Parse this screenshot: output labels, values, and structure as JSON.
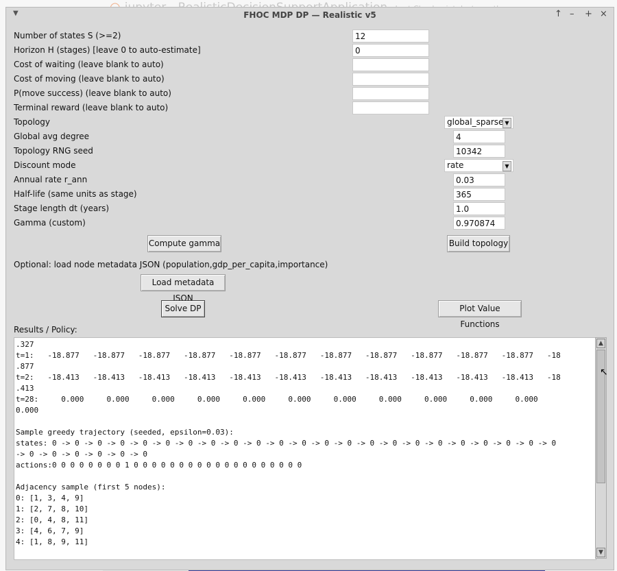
{
  "background": {
    "logo": "◠",
    "app_name": "jupyter",
    "notebook_title": "RealisticDecisionSupportApplication",
    "checkpoint": "Last Checkpoint: last month"
  },
  "window": {
    "title": "FHOC MDP DP — Realistic v5",
    "controls": {
      "menu": "▼",
      "up": "↑",
      "minimize": "–",
      "maximize": "+",
      "close": "×"
    }
  },
  "form": {
    "num_states": {
      "label": "Number of states S (>=2)",
      "value": "12"
    },
    "horizon": {
      "label": "Horizon H (stages) [leave 0 to auto-estimate]",
      "value": "0"
    },
    "cost_waiting": {
      "label": "Cost of waiting (leave blank to auto)",
      "value": ""
    },
    "cost_moving": {
      "label": "Cost of moving (leave blank to auto)",
      "value": ""
    },
    "p_move": {
      "label": "P(move success) (leave blank to auto)",
      "value": ""
    },
    "terminal_reward": {
      "label": "Terminal reward (leave blank to auto)",
      "value": ""
    },
    "topology": {
      "label": "Topology",
      "value": "global_sparse"
    },
    "global_avg_degree": {
      "label": "Global avg degree",
      "value": "4"
    },
    "topology_seed": {
      "label": "Topology RNG seed",
      "value": "10342"
    },
    "discount_mode": {
      "label": "Discount mode",
      "value": "rate"
    },
    "annual_rate": {
      "label": "Annual rate r_ann",
      "value": "0.03"
    },
    "half_life": {
      "label": "Half-life (same units as stage)",
      "value": "365"
    },
    "stage_length": {
      "label": "Stage length dt (years)",
      "value": "1.0"
    },
    "gamma": {
      "label": "Gamma (custom)",
      "value": "0.970874"
    }
  },
  "buttons": {
    "compute_gamma": "Compute gamma",
    "build_topology": "Build topology",
    "load_metadata": "Load metadata JSON",
    "solve": "Solve DP",
    "plot": "Plot Value Functions"
  },
  "metadata_label": "Optional: load node metadata JSON (population,gdp_per_capita,importance)",
  "results_label": "Results / Policy:",
  "results_lines": [
    ".327",
    "t=1:   -18.877   -18.877   -18.877   -18.877   -18.877   -18.877   -18.877   -18.877   -18.877   -18.877   -18.877   -18",
    ".877",
    "t=2:   -18.413   -18.413   -18.413   -18.413   -18.413   -18.413   -18.413   -18.413   -18.413   -18.413   -18.413   -18",
    ".413",
    "t=28:     0.000     0.000     0.000     0.000     0.000     0.000     0.000     0.000     0.000     0.000     0.000",
    "0.000",
    "",
    "Sample greedy trajectory (seeded, epsilon=0.03):",
    "states: 0 -> 0 -> 0 -> 0 -> 0 -> 0 -> 0 -> 0 -> 0 -> 0 -> 0 -> 0 -> 0 -> 0 -> 0 -> 0 -> 0 -> 0 -> 0 -> 0 -> 0 -> 0 -> 0",
    "-> 0 -> 0 -> 0 -> 0 -> 0 -> 0",
    "actions:0 0 0 0 0 0 0 0 1 0 0 0 0 0 0 0 0 0 0 0 0 0 0 0 0 0 0 0",
    "",
    "Adjacency sample (first 5 nodes):",
    "0: [1, 3, 4, 9]",
    "1: [2, 7, 8, 10]",
    "2: [0, 4, 8, 11]",
    "3: [4, 6, 7, 9]",
    "4: [1, 8, 9, 11]"
  ],
  "scrollbar": {
    "up": "▲",
    "down": "▼"
  }
}
